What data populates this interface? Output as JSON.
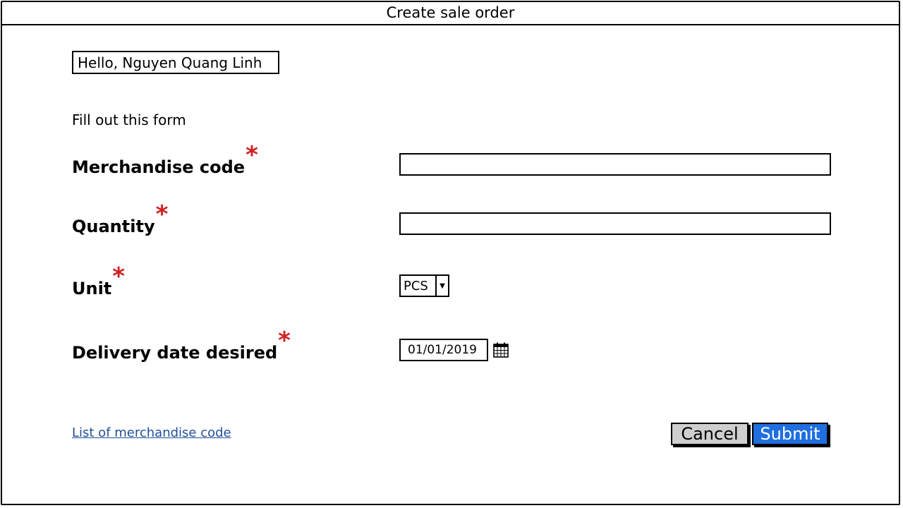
{
  "window": {
    "title": "Create sale order"
  },
  "greeting": "Hello, Nguyen Quang Linh",
  "instructions": "Fill out this form",
  "required_marker": "*",
  "fields": {
    "merchandise_code": {
      "label": "Merchandise code",
      "value": ""
    },
    "quantity": {
      "label": "Quantity",
      "value": ""
    },
    "unit": {
      "label": "Unit",
      "value": "PCS"
    },
    "delivery_date": {
      "label": "Delivery date desired",
      "value": "01/01/2019"
    }
  },
  "links": {
    "merchandise_list": "List of merchandise code"
  },
  "buttons": {
    "cancel": "Cancel",
    "submit": "Submit"
  },
  "colors": {
    "required": "#d0201f",
    "submit_bg": "#1f6fe0",
    "cancel_bg": "#cfcfcf",
    "link": "#1f4f9a"
  },
  "icons": {
    "date_picker": "calendar-icon",
    "dropdown": "chevron-down-icon"
  }
}
